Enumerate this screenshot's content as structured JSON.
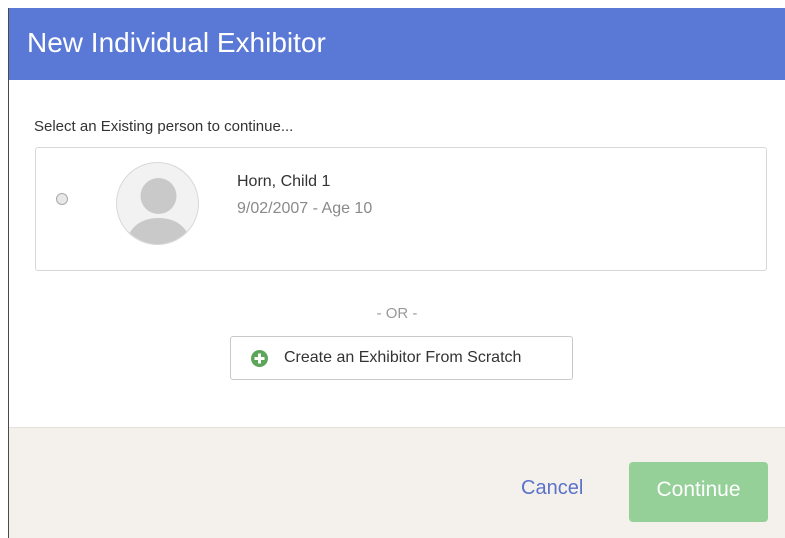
{
  "header": {
    "title": "New Individual Exhibitor"
  },
  "selection": {
    "prompt": "Select an Existing person to continue...",
    "people": [
      {
        "name": "Horn, Child 1",
        "info": "9/02/2007 - Age 10",
        "selected": false,
        "avatar_icon": "user-avatar-icon"
      }
    ]
  },
  "divider": {
    "text": "- OR -"
  },
  "create": {
    "label": "Create an Exhibitor From Scratch",
    "icon": "plus-circle-icon"
  },
  "footer": {
    "cancel_label": "Cancel",
    "continue_label": "Continue"
  },
  "colors": {
    "header": "#5a78d6",
    "continue_button": "#94d097",
    "cancel_link": "#5a72c9",
    "plus_icon": "#5ca65c",
    "footer": "#f4f1ed"
  }
}
